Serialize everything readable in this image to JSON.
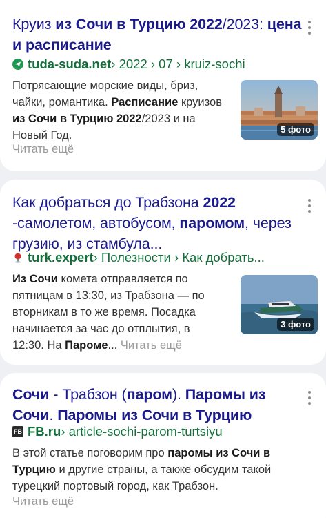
{
  "results": [
    {
      "title_parts": [
        {
          "t": "Круиз ",
          "b": false
        },
        {
          "t": "из Сочи в Турцию 2022",
          "b": true
        },
        {
          "t": "/2023: ",
          "b": false
        },
        {
          "t": "цена и расписание",
          "b": true
        }
      ],
      "domain": "tuda-suda.net",
      "path": " › 2022 › 07 › kruiz-sochi",
      "desc_parts": [
        {
          "t": "Потрясающие морские виды, бриз, чайки, романтика. ",
          "b": false
        },
        {
          "t": "Расписание",
          "b": true
        },
        {
          "t": " круизов ",
          "b": false
        },
        {
          "t": "из Сочи в Турцию 2022",
          "b": true
        },
        {
          "t": "/2023 и на Новый Год.",
          "b": false
        }
      ],
      "read_more": "Читать ещё",
      "photo_badge": "5 фото",
      "favicon": "paper-plane-icon"
    },
    {
      "title_parts": [
        {
          "t": "Как добраться до Трабзона ",
          "b": false
        },
        {
          "t": "2022",
          "b": true
        },
        {
          "t": " -самолетом, автобусом, ",
          "b": false
        },
        {
          "t": "паромом",
          "b": true
        },
        {
          "t": ", через грузию, из стамбула...",
          "b": false
        }
      ],
      "domain": "turk.expert",
      "path": " › Полезности › Как добрать...",
      "desc_parts": [
        {
          "t": "Из Сочи",
          "b": true
        },
        {
          "t": " комета отправляется по пятницам в 13:30, из Трабзона — по вторникам в то же время. Посадка начинается за час до отплытия, в 12:30. На ",
          "b": false
        },
        {
          "t": "Пароме",
          "b": true
        },
        {
          "t": "... ",
          "b": false
        }
      ],
      "read_more": "Читать ещё",
      "photo_badge": "3 фото",
      "favicon": "pin-icon"
    },
    {
      "title_parts": [
        {
          "t": "Сочи",
          "b": true
        },
        {
          "t": " - Трабзон (",
          "b": false
        },
        {
          "t": "паром",
          "b": true
        },
        {
          "t": "). ",
          "b": false
        },
        {
          "t": "Паромы из Сочи",
          "b": true
        },
        {
          "t": ". ",
          "b": false
        },
        {
          "t": "Паромы из Сочи в Турцию",
          "b": true
        }
      ],
      "domain": "FB.ru",
      "favicon_text": "FB",
      "path": " › article-sochi-parom-turtsiyu",
      "desc_parts": [
        {
          "t": "В этой статье поговорим про ",
          "b": false
        },
        {
          "t": "паромы из Сочи в Турцию",
          "b": true
        },
        {
          "t": " и другие страны, а также обсудим такой турецкий портовый город, как Трабзон.",
          "b": false
        }
      ],
      "read_more": "Читать ещё",
      "favicon": "fb-logo-icon"
    }
  ],
  "colors": {
    "title": "#1a1a8a",
    "domain": "#12703a",
    "muted": "#9a9a9a"
  }
}
